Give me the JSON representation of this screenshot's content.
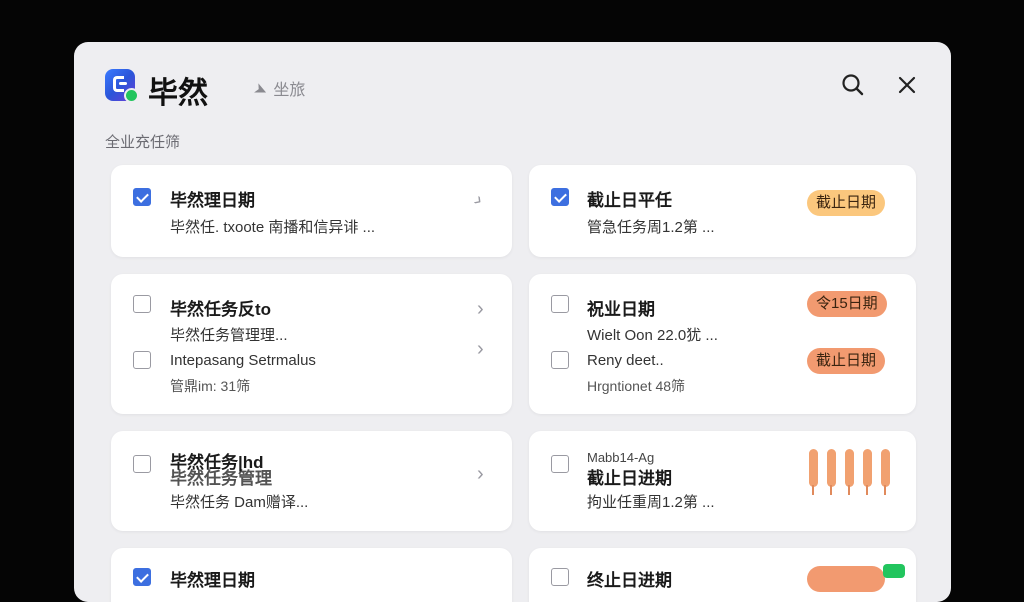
{
  "app": {
    "title": "毕然",
    "subnav": "坐旅",
    "subnav_icon": "send-icon",
    "section_label": "全业充任筛"
  },
  "colors": {
    "accent": "#3d6fe0",
    "badge_yellow": "#fbc77d",
    "badge_orange": "#f29a70",
    "logo_green": "#22c55e"
  },
  "cards": [
    {
      "title": "毕然理日期",
      "subtitle": "毕然任. txoote 南播和信异诽 ...",
      "checked": true
    },
    {
      "title": "截止日平任",
      "subtitle": "管急任务周1.2第 ...",
      "checked": true,
      "badge": "截止日期"
    },
    {
      "items": [
        {
          "title": "毕然任务反to",
          "subtitle": "毕然任务管理理..."
        },
        {
          "title": "Intepasang Setrmalus",
          "subtitle": "管鼎im: 31筛"
        }
      ]
    },
    {
      "items": [
        {
          "title": "祝业日期",
          "subtitle": "Wielt Oon 22.0犹 ...",
          "badge": "令15日期"
        },
        {
          "title": "Reny deet..",
          "subtitle": "Hrgntionet  48筛",
          "badge": "截止日期"
        }
      ]
    },
    {
      "title": "毕然任务|hd",
      "overlay": "毕然任务管理",
      "subtitle": "毕然任务 Dam赠译..."
    },
    {
      "small": "Mabb14-Ag",
      "title": "截止日进期",
      "subtitle": "拘业任重周1.2第 ..."
    },
    {
      "title": "毕然理日期"
    },
    {
      "title": "终止日进期"
    }
  ]
}
